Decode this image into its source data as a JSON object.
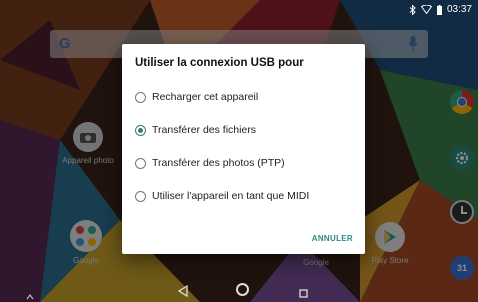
{
  "status_bar": {
    "time": "03:37",
    "icons": [
      "bluetooth-icon",
      "wifi-icon",
      "battery-icon"
    ]
  },
  "search_bar": {
    "logo_text": "G",
    "icons": [
      "google-logo-icon",
      "mic-icon"
    ]
  },
  "home": {
    "apps": [
      {
        "label": "Appareil photo",
        "icon": "camera-icon"
      },
      {
        "label": "Google",
        "icon": "google-folder-icon"
      },
      {
        "label": "Google",
        "icon": "google-folder-icon"
      },
      {
        "label": "Play Store",
        "icon": "play-store-icon"
      },
      {
        "label": "",
        "icon": "chrome-icon"
      },
      {
        "label": "",
        "icon": "settings-icon"
      },
      {
        "label": "",
        "icon": "clock-icon"
      },
      {
        "label": "",
        "icon": "calendar-icon"
      }
    ],
    "calendar_day": "31"
  },
  "dialog": {
    "title": "Utiliser la connexion USB pour",
    "options": [
      {
        "label": "Recharger cet appareil",
        "selected": false
      },
      {
        "label": "Transférer des fichiers",
        "selected": true
      },
      {
        "label": "Transférer des photos (PTP)",
        "selected": false
      },
      {
        "label": "Utiliser l'appareil en tant que MIDI",
        "selected": false
      }
    ],
    "cancel_label": "ANNULER"
  },
  "nav_bar": {
    "buttons": [
      "back-icon",
      "home-icon",
      "recents-icon",
      "expand-up-icon"
    ]
  },
  "colors": {
    "accent": "#3a7a74",
    "button_text": "#2e8a80",
    "dialog_bg": "#ffffff"
  }
}
